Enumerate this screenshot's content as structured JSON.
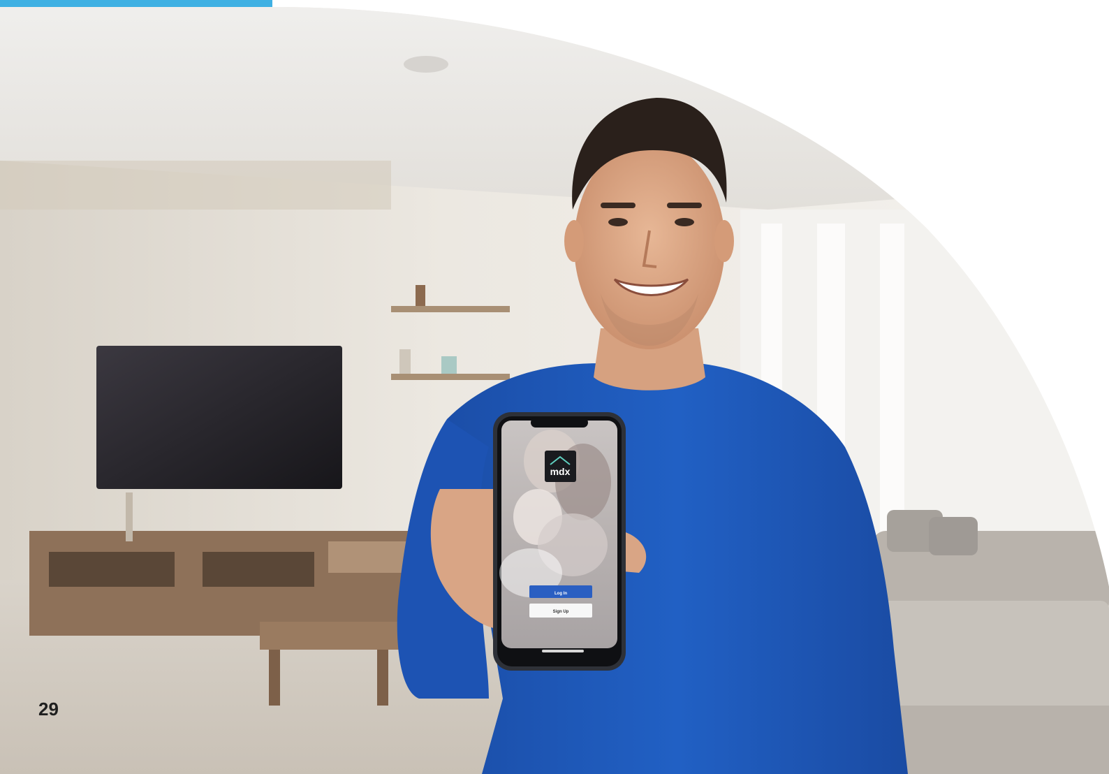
{
  "page": {
    "number": "29"
  },
  "phone": {
    "app_logo_text": "mdx",
    "primary_button_label": "Log In",
    "secondary_button_label": "Sign Up"
  },
  "colors": {
    "accent_bar": "#3fb0e3",
    "shirt_blue": "#1f56b5",
    "app_button_blue": "#2a5fc2"
  }
}
